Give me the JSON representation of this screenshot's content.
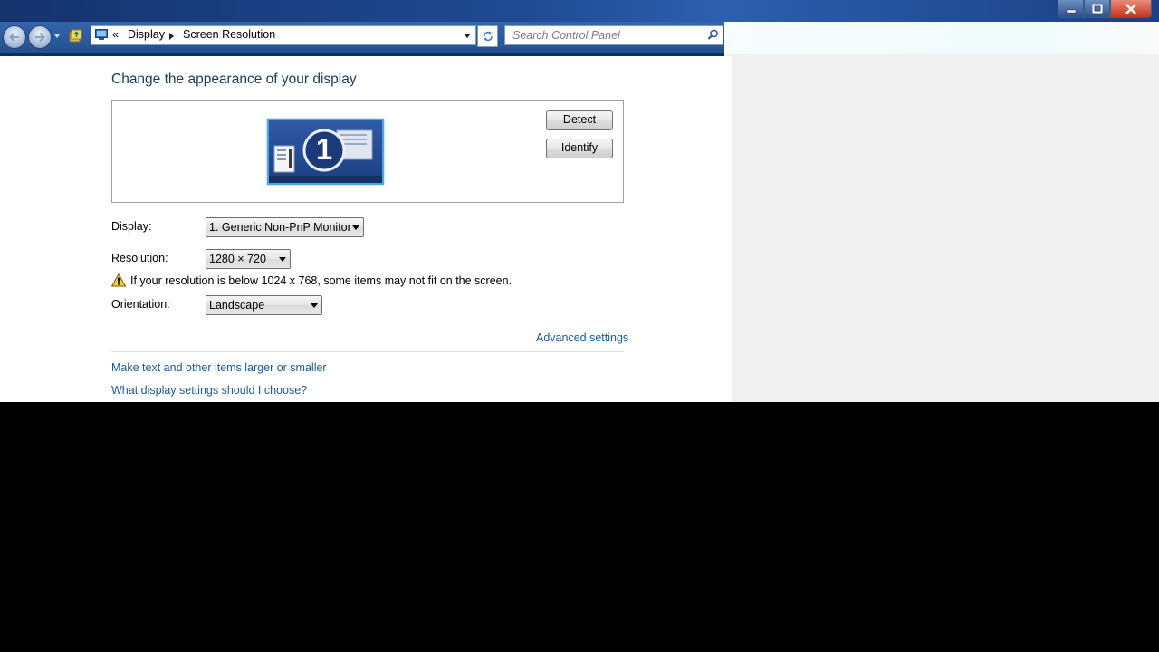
{
  "window": {
    "controls": [
      "minimize-icon",
      "restore-icon",
      "close-icon"
    ]
  },
  "nav": {
    "back_icon": "back-arrow-icon",
    "forward_icon": "forward-arrow-icon",
    "breadcrumb": {
      "overflow": "«",
      "items": [
        "Display",
        "Screen Resolution"
      ]
    },
    "search_placeholder": "Search Control Panel"
  },
  "main": {
    "heading": "Change the appearance of your display",
    "monitor_number": "1",
    "buttons": {
      "detect": "Detect",
      "identify": "Identify"
    },
    "display_label": "Display:",
    "display_value": "1. Generic Non-PnP Monitor",
    "resolution_label": "Resolution:",
    "resolution_value": "1280 × 720",
    "warning_text": "If your resolution is below 1024 x 768, some items may not fit on the screen.",
    "orientation_label": "Orientation:",
    "orientation_value": "Landscape",
    "advanced_link": "Advanced settings",
    "links": [
      "Make text and other items larger or smaller",
      "What display settings should I choose?"
    ]
  },
  "colors": {
    "link": "#1a5a9c",
    "heading": "#1e395b",
    "titlebar": "#1f4a92"
  }
}
